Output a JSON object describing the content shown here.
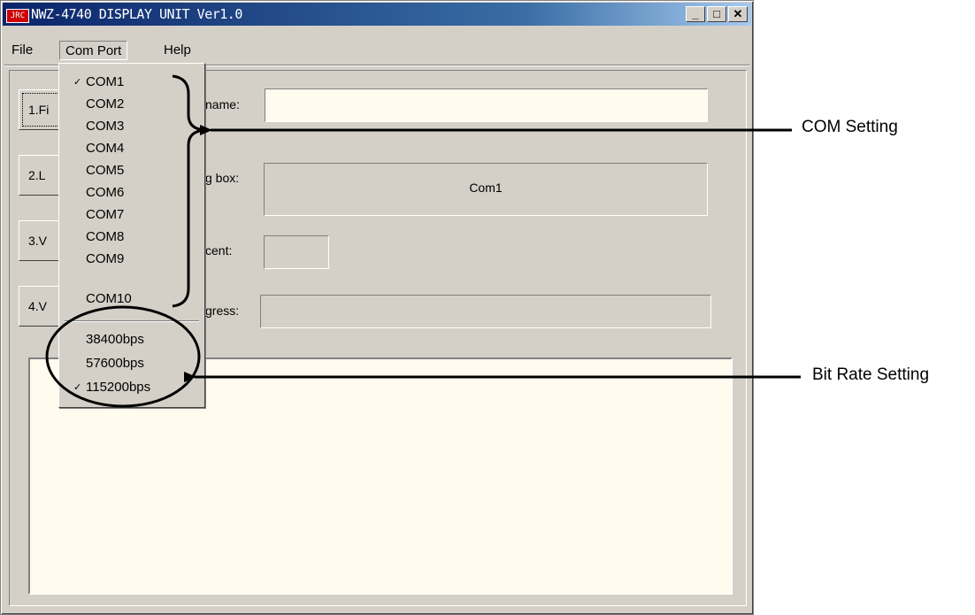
{
  "window": {
    "title": "NWZ-4740 DISPLAY UNIT Ver1.0",
    "logo_text": "JRC",
    "minimize": "_",
    "maximize": "□",
    "close": "✕"
  },
  "menubar": {
    "file": "File",
    "com_port": "Com Port",
    "help": "Help"
  },
  "buttons": [
    {
      "label": "1.Fi"
    },
    {
      "label": "2.L"
    },
    {
      "label": "3.V"
    },
    {
      "label": "4.V"
    }
  ],
  "fields": {
    "name_label": "name:",
    "box_label": "g box:",
    "box_value": "Com1",
    "percent_label": "cent:",
    "progress_label": "gress:"
  },
  "com_menu": {
    "ports": [
      {
        "label": "COM1",
        "checked": true
      },
      {
        "label": "COM2",
        "checked": false
      },
      {
        "label": "COM3",
        "checked": false
      },
      {
        "label": "COM4",
        "checked": false
      },
      {
        "label": "COM5",
        "checked": false
      },
      {
        "label": "COM6",
        "checked": false
      },
      {
        "label": "COM7",
        "checked": false
      },
      {
        "label": "COM8",
        "checked": false
      },
      {
        "label": "COM9",
        "checked": false
      },
      {
        "label": "COM10",
        "checked": false
      }
    ],
    "rates": [
      {
        "label": "38400bps",
        "checked": false
      },
      {
        "label": "57600bps",
        "checked": false
      },
      {
        "label": "115200bps",
        "checked": true
      }
    ],
    "check_mark": "✓"
  },
  "annotations": {
    "com_setting": "COM Setting",
    "bit_rate_setting": "Bit Rate Setting"
  },
  "colors": {
    "window_face": "#d4d0c8",
    "field_bg": "#fffbef",
    "title_start": "#0a246a",
    "logo_red": "#cc0000"
  }
}
